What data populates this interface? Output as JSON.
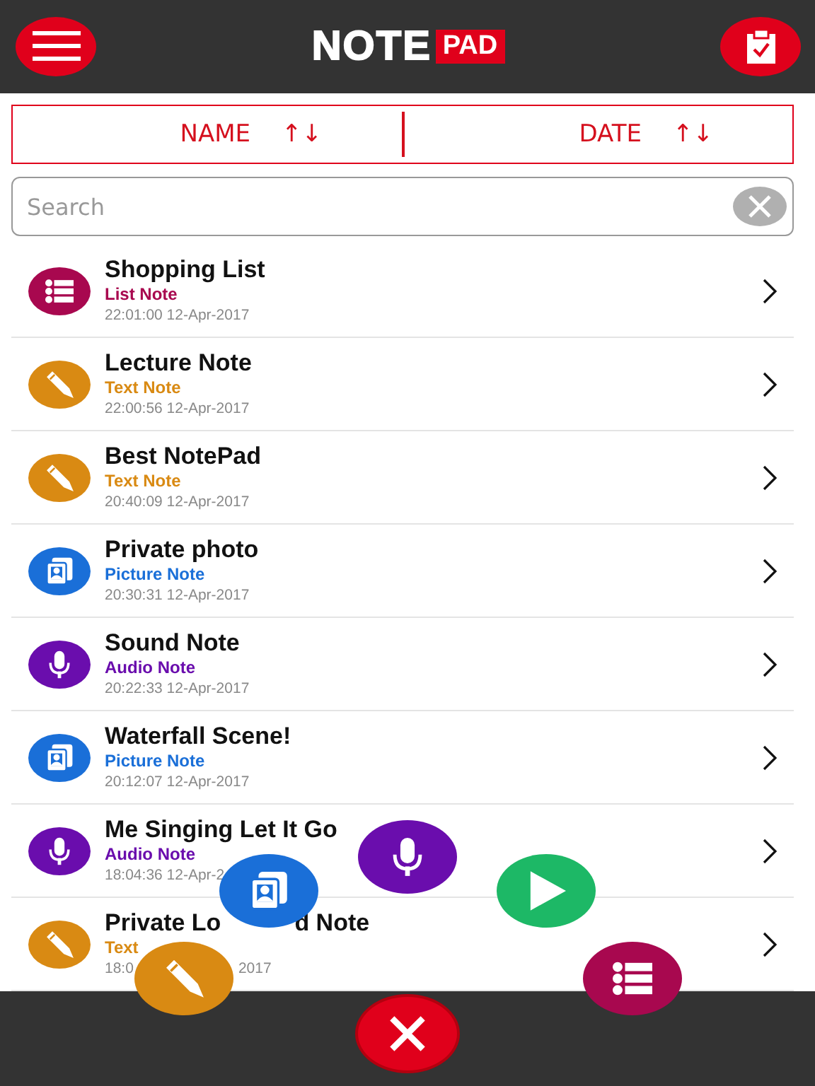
{
  "header": {
    "logo_main": "NOTE",
    "logo_badge": "PAD"
  },
  "sort_bar": [
    {
      "label": "NAME",
      "arrows": "↑↓"
    },
    {
      "label": "DATE",
      "arrows": "↑↓"
    }
  ],
  "search": {
    "placeholder": "Search"
  },
  "notes": [
    {
      "kind": "list",
      "color": "#a8084f",
      "title": [
        "Shopping List"
      ],
      "type": [
        "List Note"
      ],
      "date": [
        "22:01:00 12-Apr-2017"
      ]
    },
    {
      "kind": "text",
      "color": "#d98a13",
      "title": [
        "Lecture Note"
      ],
      "type": [
        "Text Note"
      ],
      "date": [
        "22:00:56 12-Apr-2017"
      ]
    },
    {
      "kind": "text",
      "color": "#d98a13",
      "title": [
        "Best NotePad"
      ],
      "type": [
        "Text Note"
      ],
      "date": [
        "20:40:09 12-Apr-2017"
      ]
    },
    {
      "kind": "picture",
      "color": "#1a6fd8",
      "title": [
        "Private photo"
      ],
      "type": [
        "Picture Note"
      ],
      "date": [
        "20:30:31 12-Apr-2017"
      ]
    },
    {
      "kind": "audio",
      "color": "#6a0dad",
      "title": [
        "Sound Note"
      ],
      "type": [
        "Audio Note"
      ],
      "date": [
        "20:22:33 12-Apr-2017"
      ]
    },
    {
      "kind": "picture",
      "color": "#1a6fd8",
      "title": [
        "Waterfall Scene!"
      ],
      "type": [
        "Picture Note"
      ],
      "date": [
        "20:12:07 12-Apr-2017"
      ]
    },
    {
      "kind": "audio",
      "color": "#6a0dad",
      "title": [
        "Me Singing Let It Go"
      ],
      "type": [
        "Audio Note"
      ],
      "date": [
        "18:04:36 12-Apr-2"
      ]
    },
    {
      "kind": "text",
      "color": "#d98a13",
      "title": [
        "Private Lo",
        "d Note"
      ],
      "type": [
        "Text"
      ],
      "date": [
        "18:0",
        "2017"
      ]
    }
  ],
  "fabs": [
    {
      "kind": "picture",
      "color": "#1a6fd8"
    },
    {
      "kind": "audio",
      "color": "#6a0dad"
    },
    {
      "kind": "play",
      "color": "#1db866"
    },
    {
      "kind": "text",
      "color": "#d98a13"
    },
    {
      "kind": "list",
      "color": "#a8084f"
    },
    {
      "kind": "close",
      "color": "#e0001b"
    }
  ]
}
